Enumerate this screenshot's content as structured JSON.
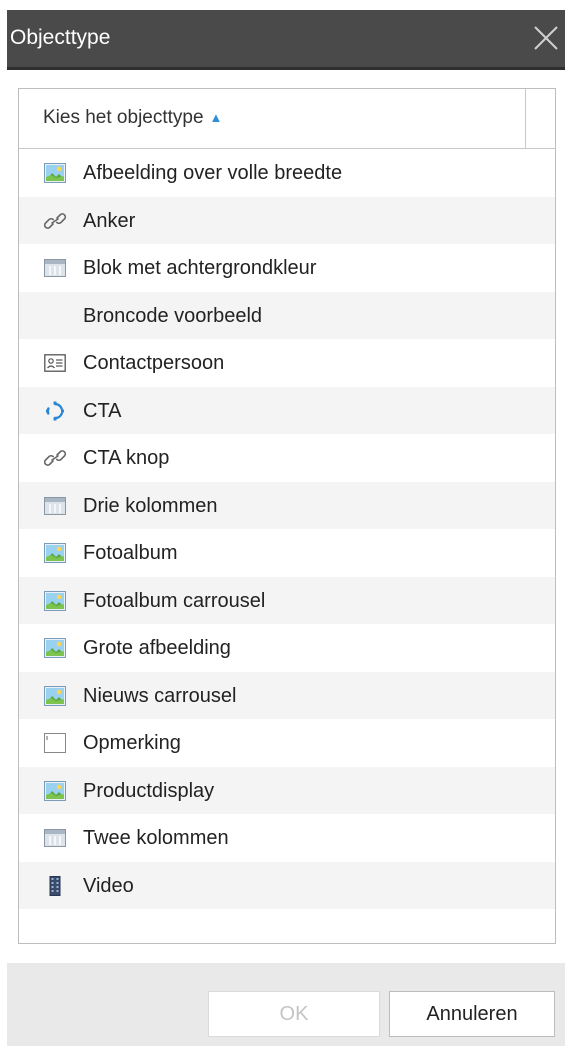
{
  "dialog": {
    "title": "Objecttype",
    "close_icon": "close-icon"
  },
  "table": {
    "header_label": "Kies het objecttype",
    "sort_indicator": "▲",
    "rows": [
      {
        "label": "Afbeelding over volle breedte",
        "icon": "image-icon"
      },
      {
        "label": "Anker",
        "icon": "link-icon"
      },
      {
        "label": "Blok met achtergrondkleur",
        "icon": "columns-icon"
      },
      {
        "label": "Broncode voorbeeld",
        "icon": ""
      },
      {
        "label": "Contactpersoon",
        "icon": "contact-card-icon"
      },
      {
        "label": "CTA",
        "icon": "gear-icon"
      },
      {
        "label": "CTA knop",
        "icon": "link-icon"
      },
      {
        "label": "Drie kolommen",
        "icon": "columns-icon"
      },
      {
        "label": "Fotoalbum",
        "icon": "image-icon"
      },
      {
        "label": "Fotoalbum carrousel",
        "icon": "image-icon"
      },
      {
        "label": "Grote afbeelding",
        "icon": "image-icon"
      },
      {
        "label": "Nieuws carrousel",
        "icon": "image-icon"
      },
      {
        "label": "Opmerking",
        "icon": "note-icon"
      },
      {
        "label": "Productdisplay",
        "icon": "image-icon"
      },
      {
        "label": "Twee kolommen",
        "icon": "columns-icon"
      },
      {
        "label": "Video",
        "icon": "film-icon"
      }
    ]
  },
  "buttons": {
    "ok_label": "OK",
    "cancel_label": "Annuleren"
  },
  "colors": {
    "titlebar": "#4a4a4a",
    "accent": "#2e8ed8",
    "disabled_text": "#c4c4c4"
  }
}
